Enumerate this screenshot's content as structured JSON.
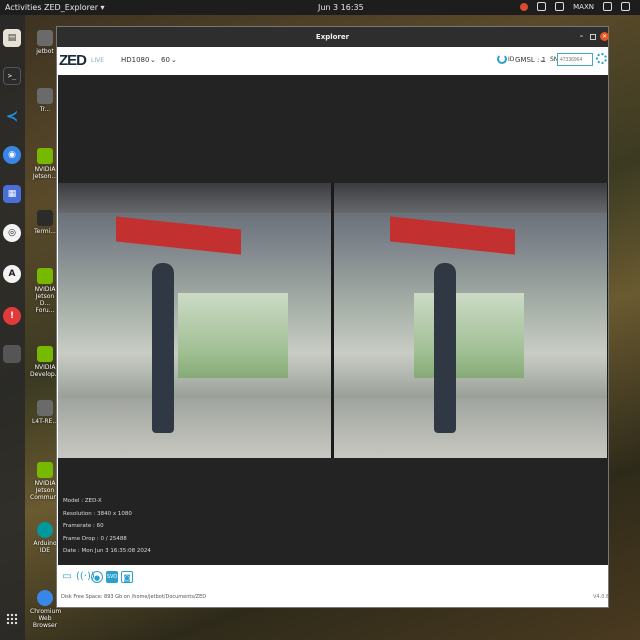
{
  "topbar": {
    "activities": "Activities",
    "app_menu": "ZED_Explorer ▾",
    "clock": "Jun 3  16:35",
    "tray_label": "MAXN"
  },
  "desktop": {
    "items": [
      {
        "label": "jetbot",
        "icon": "home-folder-icon"
      },
      {
        "label": "Tr...",
        "icon": "trash-icon"
      },
      {
        "label": "NVIDIA Jetson...",
        "icon": "nvidia-icon"
      },
      {
        "label": "Termi...",
        "icon": "terminal-icon"
      },
      {
        "label": "NVIDIA Jetson D... Foru...",
        "icon": "nvidia-icon"
      },
      {
        "label": "NVIDIA Develop...",
        "icon": "nvidia-icon"
      },
      {
        "label": "L4T-RE...",
        "icon": "document-icon"
      },
      {
        "label": "NVIDIA Jetson Community...",
        "icon": "nvidia-icon"
      },
      {
        "label": "Arduino IDE",
        "icon": "arduino-icon"
      },
      {
        "label": "Chromium Web Browser",
        "icon": "chromium-icon"
      }
    ]
  },
  "window": {
    "title": "Explorer",
    "logo": "ZED",
    "live_label": "LIVE",
    "resolution": "HD1080",
    "fps": "60",
    "id_label": "ID",
    "camera": "GMSL : 1",
    "sn_label": "SN",
    "sn_placeholder": "47336964"
  },
  "info": {
    "model": "Model : ZED-X",
    "resolution": "Resolution : 3840 x 1080",
    "framerate": "Framerate : 60",
    "frame_drop": "Frame Drop : 0 / 25488",
    "date": "Date : Mon Jun 3 16:35:08 2024"
  },
  "bottom": {
    "disk_space": "Disk Free Space: 893 Gb  on  /home/jetbot/Documents/ZED",
    "version": "V4.0.8"
  }
}
